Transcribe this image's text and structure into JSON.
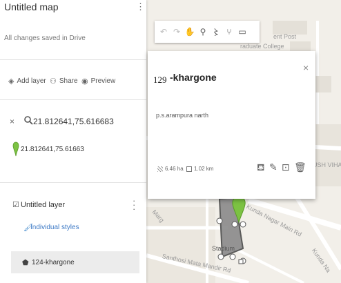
{
  "panel": {
    "map_title": "Untitled map",
    "save_status": "All changes saved in Drive",
    "actions": [
      {
        "label": "Add layer",
        "icon": "add-layer-icon"
      },
      {
        "label": "Share",
        "icon": "share-icon"
      },
      {
        "label": "Preview",
        "icon": "preview-icon"
      }
    ],
    "search": {
      "query": "21.812641,75.616683"
    },
    "search_result": {
      "text": "21.812641,75.61663",
      "pin_color": "#7cc243"
    },
    "layer": {
      "name": "Untitled layer",
      "style_link": "Individual styles",
      "feature": "124-khargone"
    }
  },
  "toolbar": {
    "tools": [
      {
        "name": "undo-icon",
        "glyph": "↶"
      },
      {
        "name": "redo-icon",
        "glyph": "↷"
      },
      {
        "name": "hand-icon",
        "glyph": "✋"
      },
      {
        "name": "marker-icon",
        "glyph": "⚲"
      },
      {
        "name": "draw-line-icon",
        "glyph": "〻"
      },
      {
        "name": "directions-icon",
        "glyph": "⑂"
      },
      {
        "name": "ruler-icon",
        "glyph": "▭"
      }
    ]
  },
  "map_labels": {
    "post_office": "ent Post",
    "college": "raduate College",
    "vihar": "USH VIHA",
    "road1": "Kunda Nagar Main Rd",
    "road2": "Santhosi Mata Mandir Rd",
    "stadium": "Stadium",
    "road3": "Kunda Na",
    "road4": "Marg"
  },
  "card": {
    "number": "129",
    "title": "-khargone",
    "description": "p.s.arampura narth",
    "area": "6.46 ha",
    "length": "1.02 km",
    "close": "×"
  },
  "colors": {
    "polygon_fill": "#8a8a8a",
    "polygon_stroke": "#4a4a4a",
    "pin": "#7cc243",
    "link": "#3b78c5"
  }
}
